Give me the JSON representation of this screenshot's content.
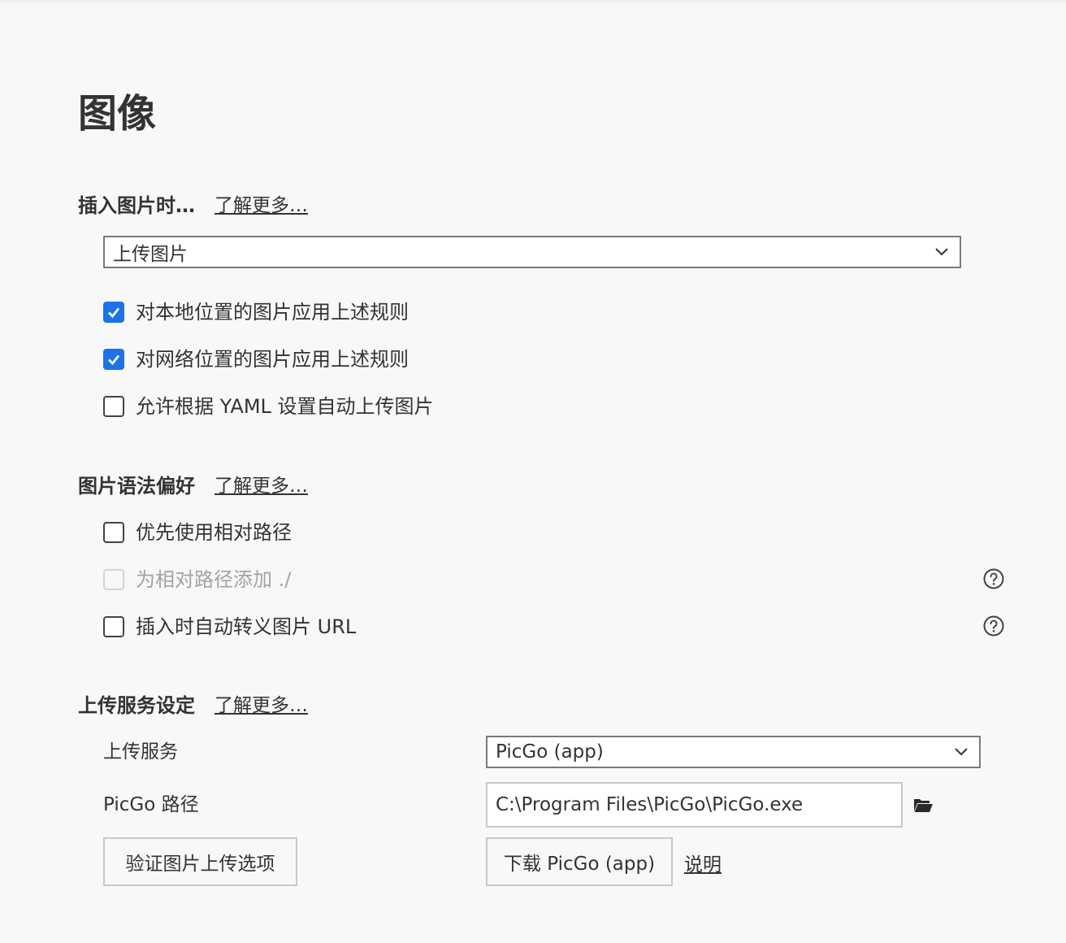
{
  "page": {
    "title": "图像"
  },
  "insert_image": {
    "title": "插入图片时…",
    "learn_more": "了解更多…",
    "select_value": "上传图片",
    "options": [
      {
        "label": "对本地位置的图片应用上述规则",
        "checked": true,
        "disabled": false
      },
      {
        "label": "对网络位置的图片应用上述规则",
        "checked": true,
        "disabled": false
      },
      {
        "label": "允许根据 YAML 设置自动上传图片",
        "checked": false,
        "disabled": false
      }
    ]
  },
  "syntax_pref": {
    "title": "图片语法偏好",
    "learn_more": "了解更多…",
    "options": [
      {
        "label": "优先使用相对路径",
        "checked": false,
        "disabled": false
      },
      {
        "label": "为相对路径添加 ./",
        "checked": false,
        "disabled": true,
        "help_icon": "question-circle-icon"
      },
      {
        "label": "插入时自动转义图片 URL",
        "checked": false,
        "disabled": false,
        "help_icon": "question-circle-icon"
      }
    ]
  },
  "upload_service": {
    "title": "上传服务设定",
    "learn_more": "了解更多…",
    "service_label": "上传服务",
    "service_value": "PicGo (app)",
    "path_label": "PicGo 路径",
    "path_value": "C:\\Program Files\\PicGo\\PicGo.exe",
    "folder_icon": "folder-open-icon",
    "verify_button": "验证图片上传选项",
    "download_button": "下载 PicGo (app)",
    "help_link": "说明"
  },
  "colors": {
    "accent": "#1a73e8",
    "background": "#f8f8f8",
    "text": "#333333"
  }
}
